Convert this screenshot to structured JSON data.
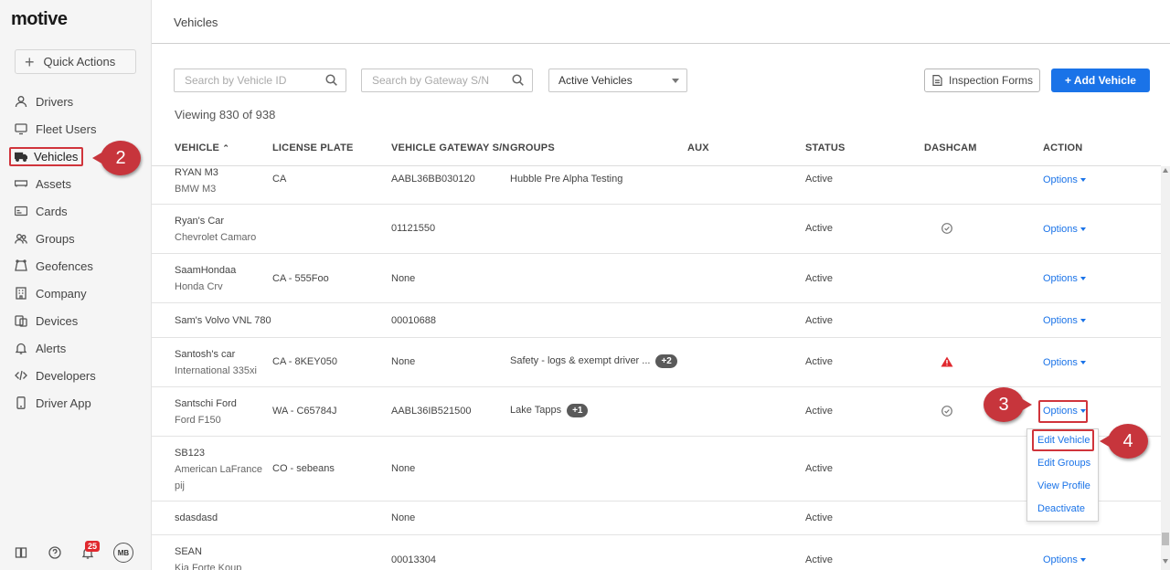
{
  "app": {
    "logo": "motive"
  },
  "sidebar": {
    "quick_actions": "Quick Actions",
    "items": [
      {
        "label": "Drivers",
        "icon": "person-icon"
      },
      {
        "label": "Fleet Users",
        "icon": "monitor-icon"
      },
      {
        "label": "Vehicles",
        "icon": "truck-icon"
      },
      {
        "label": "Assets",
        "icon": "trailer-icon"
      },
      {
        "label": "Cards",
        "icon": "card-icon"
      },
      {
        "label": "Groups",
        "icon": "group-icon"
      },
      {
        "label": "Geofences",
        "icon": "geofence-icon"
      },
      {
        "label": "Company",
        "icon": "building-icon"
      },
      {
        "label": "Devices",
        "icon": "devices-icon"
      },
      {
        "label": "Alerts",
        "icon": "bell-icon"
      },
      {
        "label": "Developers",
        "icon": "code-icon"
      },
      {
        "label": "Driver App",
        "icon": "phone-icon"
      }
    ],
    "notifications_count": "25",
    "avatar_initials": "MB"
  },
  "header": {
    "title": "Vehicles"
  },
  "toolbar": {
    "search_vehicle_placeholder": "Search by Vehicle ID",
    "search_gateway_placeholder": "Search by Gateway S/N",
    "filter_selected": "Active Vehicles",
    "inspection_forms": "Inspection Forms",
    "add_vehicle": "+ Add Vehicle"
  },
  "viewing": "Viewing 830 of 938",
  "table": {
    "headers": {
      "vehicle": "VEHICLE",
      "license": "LICENSE PLATE",
      "gateway": "VEHICLE GATEWAY S/N",
      "groups": "GROUPS",
      "aux": "AUX",
      "status": "STATUS",
      "dashcam": "DASHCAM",
      "action": "ACTION"
    },
    "options_label": "Options",
    "rows": [
      {
        "name": "RYAN M3",
        "model": "BMW M3",
        "plate": "CA",
        "gateway": "AABL36BB030120",
        "groups": "Hubble Pre Alpha Testing",
        "pill": "",
        "status": "Active",
        "dashcam": ""
      },
      {
        "name": "Ryan's Car",
        "model": "Chevrolet Camaro",
        "plate": "",
        "gateway": "01121550",
        "groups": "",
        "pill": "",
        "status": "Active",
        "dashcam": "check"
      },
      {
        "name": "SaamHondaa",
        "model": "Honda Crv",
        "plate": "CA - 555Foo",
        "gateway": "None",
        "groups": "",
        "pill": "",
        "status": "Active",
        "dashcam": ""
      },
      {
        "name": "Sam's Volvo VNL 780",
        "model": "",
        "plate": "",
        "gateway": "00010688",
        "groups": "",
        "pill": "",
        "status": "Active",
        "dashcam": ""
      },
      {
        "name": "Santosh's car",
        "model": "International 335xi",
        "plate": "CA - 8KEY050",
        "gateway": "None",
        "groups": "Safety - logs & exempt driver ...",
        "pill": "+2",
        "status": "Active",
        "dashcam": "warning"
      },
      {
        "name": "Santschi Ford",
        "model": "Ford F150",
        "plate": "WA - C65784J",
        "gateway": "AABL36IB521500",
        "groups": "Lake Tapps",
        "pill": "+1",
        "status": "Active",
        "dashcam": "check"
      },
      {
        "name": "SB123",
        "model": "American LaFrance",
        "model2": "pij",
        "plate": "CO - sebeans",
        "gateway": "None",
        "groups": "",
        "pill": "",
        "status": "Active",
        "dashcam": ""
      },
      {
        "name": "sdasdasd",
        "model": "",
        "plate": "",
        "gateway": "None",
        "groups": "",
        "pill": "",
        "status": "Active",
        "dashcam": ""
      },
      {
        "name": "SEAN",
        "model": "Kia Forte Koup",
        "plate": "",
        "gateway": "00013304",
        "groups": "",
        "pill": "",
        "status": "Active",
        "dashcam": ""
      }
    ]
  },
  "menu": {
    "items": [
      "Edit Vehicle",
      "Edit Groups",
      "View Profile",
      "Deactivate"
    ]
  },
  "callouts": [
    "2",
    "3",
    "4"
  ],
  "colors": {
    "accent": "#1a73e8",
    "highlight": "#d0343b",
    "callout": "#c7353c"
  }
}
